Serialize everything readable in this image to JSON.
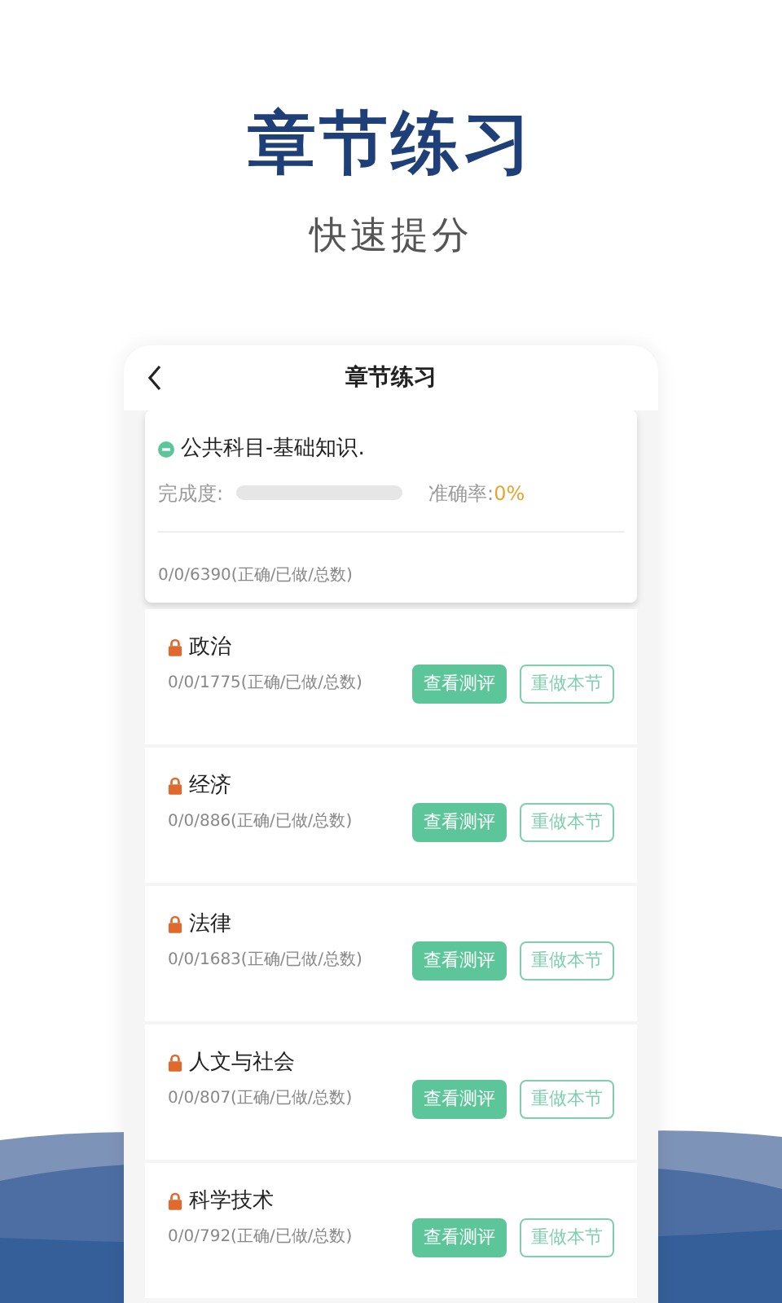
{
  "headline": "章节练习",
  "subtitle": "快速提分",
  "screen": {
    "title": "章节练习",
    "summary": {
      "title": "公共科目-基础知识.",
      "progress_label": "完成度:",
      "level": 0,
      "accuracy_label": "准确率:",
      "accuracy_value": "0%",
      "stats": "0/0/6390(正确/已做/总数)"
    },
    "sections": [
      {
        "name": "政治",
        "locked": true,
        "stats": "0/0/1775(正确/已做/总数)",
        "buttons": [
          "查看测评",
          "重做本节"
        ]
      },
      {
        "name": "经济",
        "locked": true,
        "stats": "0/0/886(正确/已做/总数)",
        "buttons": [
          "查看测评",
          "重做本节"
        ]
      },
      {
        "name": "法律",
        "locked": true,
        "stats": "0/0/1683(正确/已做/总数)",
        "buttons": [
          "查看测评",
          "重做本节"
        ]
      },
      {
        "name": "人文与社会",
        "locked": true,
        "stats": "0/0/807(正确/已做/总数)",
        "buttons": [
          "查看测评",
          "重做本节"
        ]
      },
      {
        "name": "科学技术",
        "locked": true,
        "stats": "0/0/792(正确/已做/总数)",
        "buttons": [
          "查看测评",
          "重做本节"
        ]
      }
    ]
  }
}
